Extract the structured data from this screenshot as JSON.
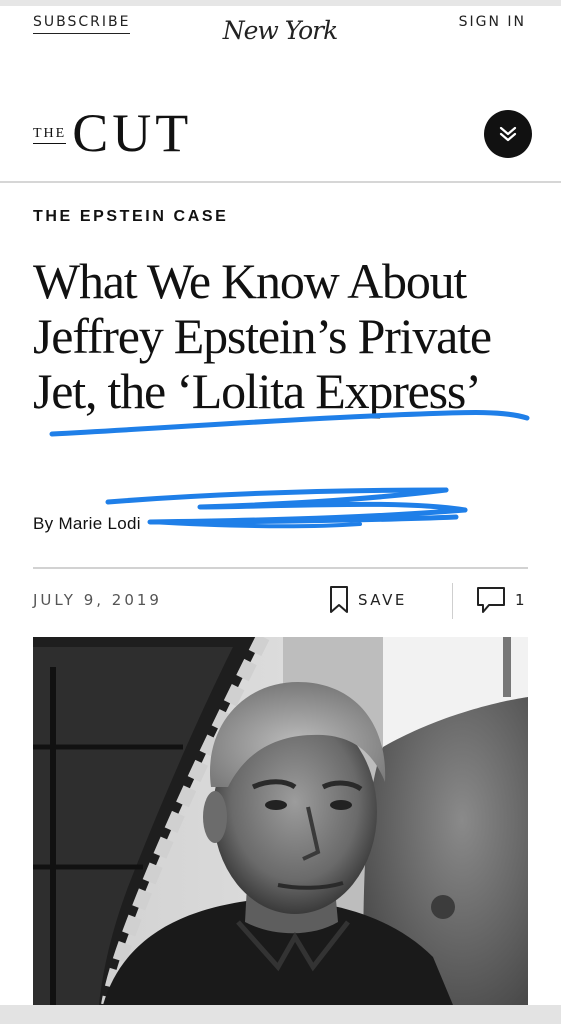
{
  "header": {
    "subscribe_label": "SUBSCRIBE",
    "brand": "New York",
    "signin_label": "SIGN IN"
  },
  "section": {
    "the_label": "THE",
    "name": "CUT",
    "menu_icon": "double-chevron-down-icon"
  },
  "article": {
    "rubric": "THE EPSTEIN CASE",
    "headline": "What We Know About Jeffrey Epstein’s Private Jet, the ‘Lolita Express’",
    "byline": "By Marie Lodi",
    "date": "JULY 9, 2019",
    "save_label": "SAVE",
    "comment_count": "1"
  },
  "colors": {
    "text": "#111111",
    "annotation_blue": "#1f7fe8",
    "menu_button": "#111111"
  }
}
